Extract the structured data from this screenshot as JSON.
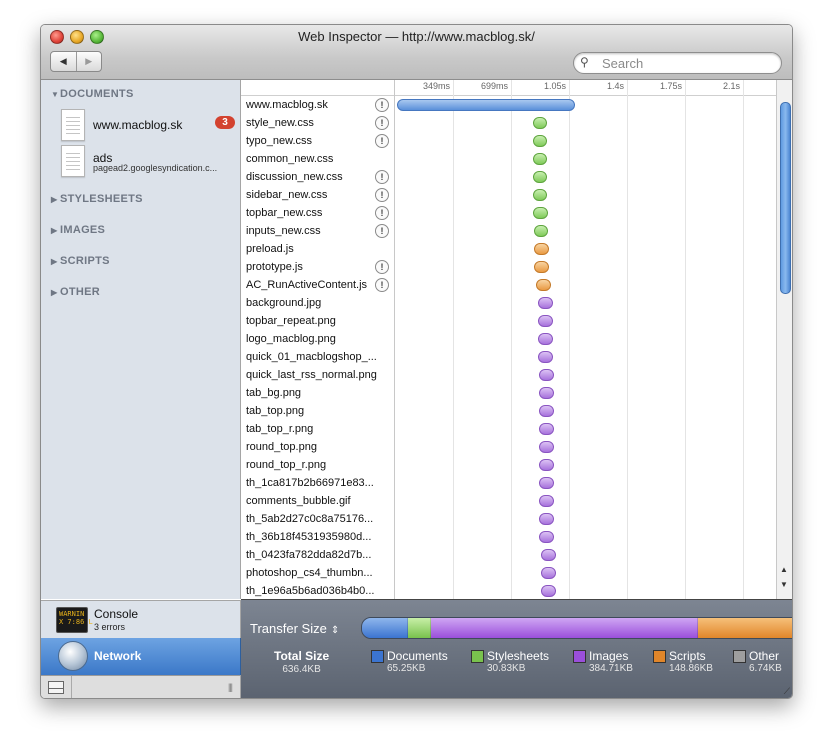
{
  "window": {
    "title": "Web Inspector — http://www.macblog.sk/"
  },
  "toolbar": {
    "back": "◀",
    "forward": "▶",
    "search_placeholder": "Search"
  },
  "sidebar": {
    "sections": [
      "DOCUMENTS",
      "STYLESHEETS",
      "IMAGES",
      "SCRIPTS",
      "OTHER"
    ],
    "documents": [
      {
        "name": "www.macblog.sk",
        "badge": "3"
      },
      {
        "name": "ads",
        "sub": "pagead2.googlesyndication.c..."
      }
    ],
    "console": {
      "title": "Console",
      "sub": "3 errors",
      "icon_text": "WARNIN\nX 7:86 L"
    },
    "network": {
      "title": "Network"
    }
  },
  "timeline": {
    "ticks": [
      "349ms",
      "699ms",
      "1.05s",
      "1.4s",
      "1.75s",
      "2.1s"
    ],
    "tick_values_s": [
      0.349,
      0.699,
      1.05,
      1.4,
      1.75,
      2.1
    ],
    "max_s": 2.3
  },
  "resources": [
    {
      "name": "www.macblog.sk",
      "warn": true,
      "type": "doc",
      "start": 0.0,
      "end": 1.06
    },
    {
      "name": "style_new.css",
      "warn": true,
      "type": "css",
      "start": 0.82,
      "end": 0.89
    },
    {
      "name": "typo_new.css",
      "warn": true,
      "type": "css",
      "start": 0.82,
      "end": 0.89
    },
    {
      "name": "common_new.css",
      "warn": false,
      "type": "css",
      "start": 0.82,
      "end": 0.89
    },
    {
      "name": "discussion_new.css",
      "warn": true,
      "type": "css",
      "start": 0.82,
      "end": 0.89
    },
    {
      "name": "sidebar_new.css",
      "warn": true,
      "type": "css",
      "start": 0.82,
      "end": 0.89
    },
    {
      "name": "topbar_new.css",
      "warn": true,
      "type": "css",
      "start": 0.82,
      "end": 0.9
    },
    {
      "name": "inputs_new.css",
      "warn": true,
      "type": "css",
      "start": 0.83,
      "end": 0.9
    },
    {
      "name": "preload.js",
      "warn": false,
      "type": "js",
      "start": 0.83,
      "end": 0.91
    },
    {
      "name": "prototype.js",
      "warn": true,
      "type": "js",
      "start": 0.83,
      "end": 0.91
    },
    {
      "name": "AC_RunActiveContent.js",
      "warn": true,
      "type": "js",
      "start": 0.84,
      "end": 0.92
    },
    {
      "name": "background.jpg",
      "warn": false,
      "type": "img",
      "start": 0.85,
      "end": 0.93
    },
    {
      "name": "topbar_repeat.png",
      "warn": false,
      "type": "img",
      "start": 0.85,
      "end": 0.93
    },
    {
      "name": "logo_macblog.png",
      "warn": false,
      "type": "img",
      "start": 0.85,
      "end": 0.93
    },
    {
      "name": "quick_01_macblogshop_...",
      "warn": false,
      "type": "img",
      "start": 0.85,
      "end": 0.93
    },
    {
      "name": "quick_last_rss_normal.png",
      "warn": false,
      "type": "img",
      "start": 0.86,
      "end": 0.94
    },
    {
      "name": "tab_bg.png",
      "warn": false,
      "type": "img",
      "start": 0.86,
      "end": 0.94
    },
    {
      "name": "tab_top.png",
      "warn": false,
      "type": "img",
      "start": 0.86,
      "end": 0.94
    },
    {
      "name": "tab_top_r.png",
      "warn": false,
      "type": "img",
      "start": 0.86,
      "end": 0.94
    },
    {
      "name": "round_top.png",
      "warn": false,
      "type": "img",
      "start": 0.86,
      "end": 0.94
    },
    {
      "name": "round_top_r.png",
      "warn": false,
      "type": "img",
      "start": 0.86,
      "end": 0.94
    },
    {
      "name": "th_1ca817b2b66971e83...",
      "warn": false,
      "type": "img",
      "start": 0.86,
      "end": 0.94
    },
    {
      "name": "comments_bubble.gif",
      "warn": false,
      "type": "img",
      "start": 0.86,
      "end": 0.94,
      "highlight": true
    },
    {
      "name": "th_5ab2d27c0c8a75176...",
      "warn": false,
      "type": "img",
      "start": 0.86,
      "end": 0.94
    },
    {
      "name": "th_36b18f4531935980d...",
      "warn": false,
      "type": "img",
      "start": 0.86,
      "end": 0.94
    },
    {
      "name": "th_0423fa782dda82d7b...",
      "warn": false,
      "type": "img",
      "start": 0.87,
      "end": 0.95
    },
    {
      "name": "photoshop_cs4_thumbn...",
      "warn": false,
      "type": "img",
      "start": 0.87,
      "end": 0.95
    },
    {
      "name": "th_1e96a5b6ad036b4b0...",
      "warn": false,
      "type": "img",
      "start": 0.87,
      "end": 0.95
    }
  ],
  "summary": {
    "title": "Transfer Size",
    "updown": "⇕",
    "total": {
      "label": "Total Size",
      "value": "636.4KB"
    },
    "legend": [
      {
        "label": "Documents",
        "value": "65.25KB",
        "color": "#3b74d0",
        "type": "doc"
      },
      {
        "label": "Stylesheets",
        "value": "30.83KB",
        "color": "#79c24d",
        "type": "css"
      },
      {
        "label": "Images",
        "value": "384.71KB",
        "color": "#9a4fdb",
        "type": "img"
      },
      {
        "label": "Scripts",
        "value": "148.86KB",
        "color": "#e1862a",
        "type": "js"
      },
      {
        "label": "Other",
        "value": "6.74KB",
        "color": "#9e9e9e",
        "type": "other"
      }
    ],
    "graph_kb": [
      65.25,
      30.83,
      384.71,
      148.86
    ]
  }
}
